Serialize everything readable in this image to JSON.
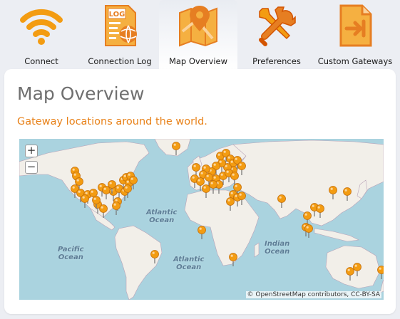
{
  "toolbar": {
    "tabs": [
      {
        "label": "Connect",
        "icon": "wifi-icon"
      },
      {
        "label": "Connection Log",
        "icon": "log-document-icon",
        "icon_text": "LOG"
      },
      {
        "label": "Map Overview",
        "icon": "map-pin-icon"
      },
      {
        "label": "Preferences",
        "icon": "tools-icon"
      },
      {
        "label": "Custom Gateways",
        "icon": "gateway-import-icon"
      }
    ],
    "selected": "Map Overview"
  },
  "page": {
    "title": "Map Overview",
    "subtitle": "Gateway locations around the world."
  },
  "map": {
    "zoom_in": "+",
    "zoom_out": "−",
    "oceans": {
      "atlantic_north": "Atlantic\nOcean",
      "atlantic_south": "Atlantic\nOcean",
      "pacific": "Pacific\nOcean",
      "indian": "Indian\nOcean"
    },
    "attribution": "© OpenStreetMap contributors, CC-BY-SA"
  },
  "colors": {
    "accent": "#f39c12",
    "subtitle": "#e8821a",
    "ocean": "#aad3df",
    "land": "#f2efe9"
  }
}
